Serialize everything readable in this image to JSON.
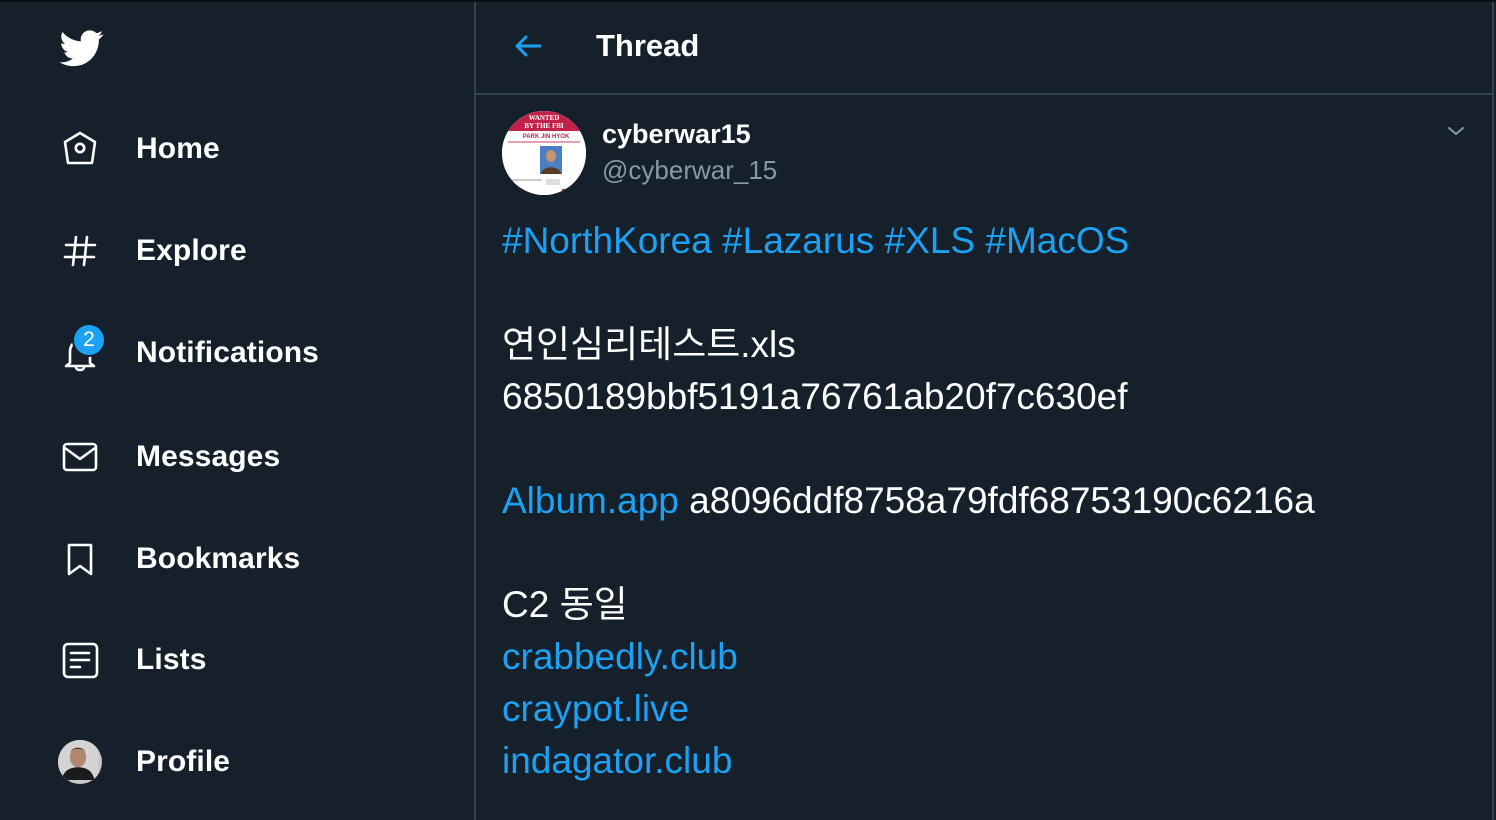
{
  "sidebar": {
    "logo": "twitter-bird-icon",
    "items": [
      {
        "label": "Home",
        "icon": "home-icon"
      },
      {
        "label": "Explore",
        "icon": "hashtag-icon"
      },
      {
        "label": "Notifications",
        "icon": "bell-icon",
        "badge": "2"
      },
      {
        "label": "Messages",
        "icon": "envelope-icon"
      },
      {
        "label": "Bookmarks",
        "icon": "bookmark-icon"
      },
      {
        "label": "Lists",
        "icon": "list-icon"
      },
      {
        "label": "Profile",
        "icon": "avatar"
      }
    ]
  },
  "header": {
    "back_icon": "arrow-left-icon",
    "title": "Thread"
  },
  "tweet": {
    "author": {
      "name": "cyberwar15",
      "handle": "@cyberwar_15",
      "avatar_caption": [
        "WANTED",
        "BY THE FBI",
        "PARK JIN HYOK"
      ]
    },
    "menu_icon": "chevron-down-icon",
    "hashtags": [
      "#NorthKorea",
      "#Lazarus",
      "#XLS",
      "#MacOS"
    ],
    "filename": "연인심리테스트.xls",
    "hash1": "6850189bbf5191a76761ab20f7c630ef",
    "app_link": "Album.app",
    "hash2": "a8096ddf8758a79fdf68753190c6216a",
    "c2_label": "C2 동일",
    "domains": [
      "crabbedly.club",
      "craypot.live",
      "indagator.club"
    ]
  },
  "colors": {
    "background": "#15202b",
    "divider": "#38444d",
    "accent": "#1da1f2",
    "secondary_text": "#8899a6",
    "text": "#ffffff"
  }
}
